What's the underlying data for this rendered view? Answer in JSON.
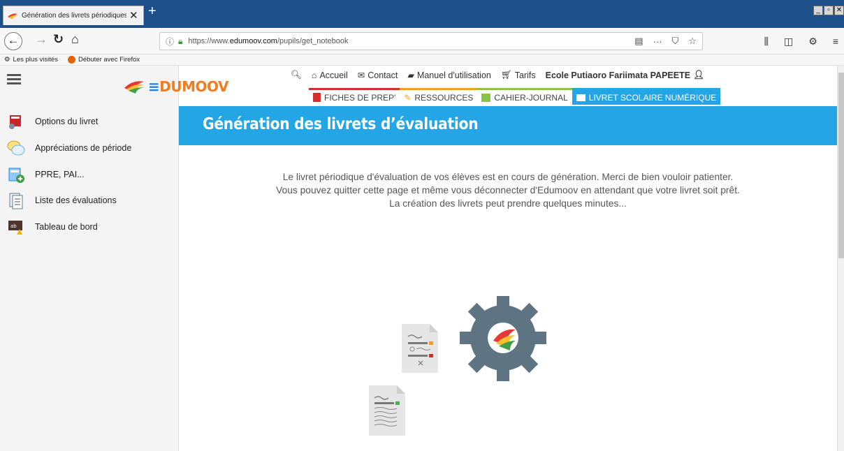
{
  "browser": {
    "tab_title": "Génération des livrets périodiques",
    "url_prefix": "https://www.",
    "url_domain": "edumoov.com",
    "url_path": "/pupils/get_notebook",
    "bookmarks": [
      "Les plus visités",
      "Débuter avec Firefox"
    ],
    "colors": {
      "tabstrip": "#1d4f88"
    }
  },
  "sidebar": {
    "items": [
      {
        "label": "Options du livret",
        "icon": "book-options-icon"
      },
      {
        "label": "Appréciations de période",
        "icon": "speech-bubbles-icon"
      },
      {
        "label": "PPRE, PAI...",
        "icon": "stack-add-icon"
      },
      {
        "label": "Liste des évaluations",
        "icon": "list-icon"
      },
      {
        "label": "Tableau de bord",
        "icon": "dashboard-board-icon"
      }
    ]
  },
  "header": {
    "logo_text_e": "≡",
    "logo_text": "DUMOOV",
    "top_nav": [
      "Accueil",
      "Contact",
      "Manuel d'utilisation",
      "Tarifs"
    ],
    "school": "Ecole Putiaoro Fariimata PAPEETE",
    "main_nav": [
      {
        "label": "FICHES DE PREP'",
        "color": "#d32f2f",
        "active": false
      },
      {
        "label": "RESSOURCES",
        "color": "#f0a020",
        "active": false
      },
      {
        "label": "CAHIER-JOURNAL",
        "color": "#8bc34a",
        "active": false
      },
      {
        "label": "LIVRET SCOLAIRE NUMÉRIQUE",
        "color": "#23a5e6",
        "active": true
      }
    ]
  },
  "main": {
    "title": "Génération des livrets d’évaluation",
    "message_lines": [
      "Le livret périodique d'évaluation de vos élèves est en cours de génération. Merci de bien vouloir patienter.",
      "Vous pouvez quitter cette page et même vous déconnecter d'Edumoov en attendant que votre livret soit prêt.",
      "La création des livrets peut prendre quelques minutes..."
    ],
    "accent": "#23a5e6"
  }
}
